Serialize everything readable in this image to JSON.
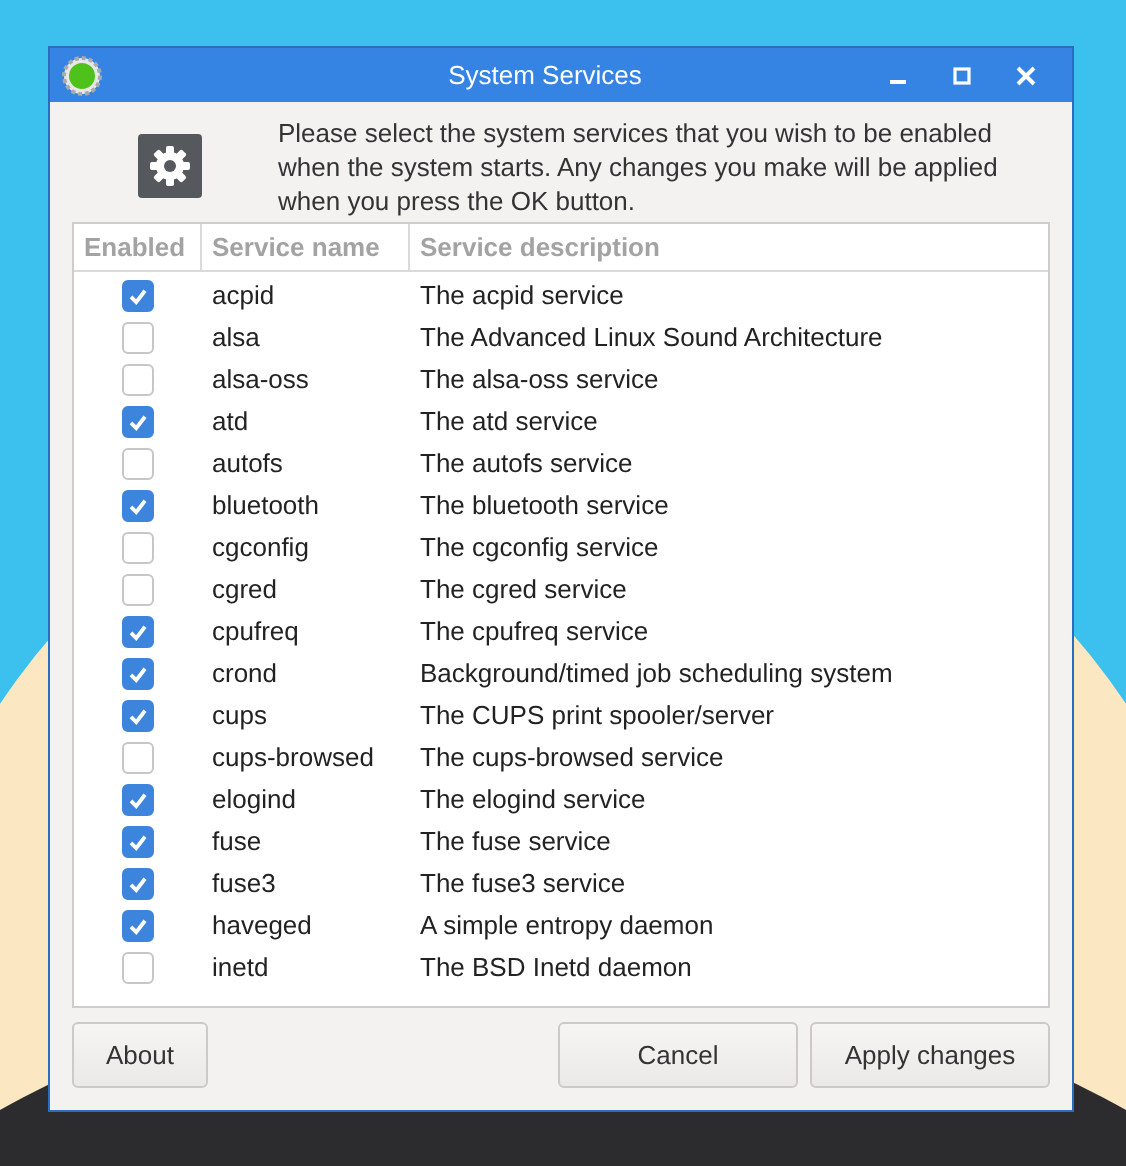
{
  "window": {
    "title": "System Services"
  },
  "intro": "Please select the system services that you wish to be enabled when the system starts. Any changes you make will be applied when you press the OK button.",
  "table": {
    "columns": [
      "Enabled",
      "Service name",
      "Service description"
    ],
    "rows": [
      {
        "name": "acpid",
        "description": "The acpid service",
        "checked": true
      },
      {
        "name": "alsa",
        "description": "The Advanced Linux Sound Architecture",
        "checked": false
      },
      {
        "name": "alsa-oss",
        "description": "The alsa-oss service",
        "checked": false
      },
      {
        "name": "atd",
        "description": "The atd service",
        "checked": true
      },
      {
        "name": "autofs",
        "description": "The autofs service",
        "checked": false
      },
      {
        "name": "bluetooth",
        "description": "The bluetooth service",
        "checked": true
      },
      {
        "name": "cgconfig",
        "description": "The cgconfig service",
        "checked": false
      },
      {
        "name": "cgred",
        "description": "The cgred service",
        "checked": false
      },
      {
        "name": "cpufreq",
        "description": "The cpufreq service",
        "checked": true
      },
      {
        "name": "crond",
        "description": "Background/timed job scheduling system",
        "checked": true
      },
      {
        "name": "cups",
        "description": "The CUPS print spooler/server",
        "checked": true
      },
      {
        "name": "cups-browsed",
        "description": "The cups-browsed service",
        "checked": false
      },
      {
        "name": "elogind",
        "description": "The elogind service",
        "checked": true
      },
      {
        "name": "fuse",
        "description": "The fuse service",
        "checked": true
      },
      {
        "name": "fuse3",
        "description": "The fuse3 service",
        "checked": true
      },
      {
        "name": "haveged",
        "description": "A simple entropy daemon",
        "checked": true
      },
      {
        "name": "inetd",
        "description": "The BSD Inetd daemon",
        "checked": false
      }
    ]
  },
  "buttons": {
    "left": [
      "About"
    ],
    "right": [
      "Cancel",
      "Apply changes"
    ]
  }
}
